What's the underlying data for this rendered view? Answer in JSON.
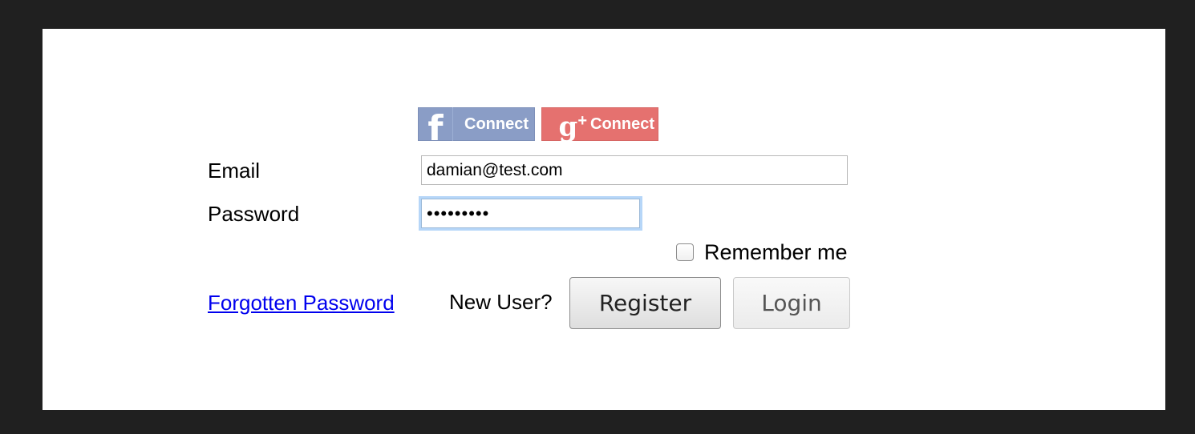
{
  "social": {
    "facebook": {
      "label": "Connect",
      "icon": "facebook-icon",
      "color": "#8a9dc6"
    },
    "google": {
      "label": "Connect",
      "icon": "google-plus-icon",
      "color": "#e5716f"
    }
  },
  "form": {
    "email_label": "Email",
    "email_value": "damian@test.com",
    "password_label": "Password",
    "password_value": "•••••••••",
    "remember_label": "Remember me",
    "remember_checked": false
  },
  "actions": {
    "forgot_link": "Forgotten Password",
    "new_user_text": "New User?",
    "register_label": "Register",
    "login_label": "Login"
  }
}
